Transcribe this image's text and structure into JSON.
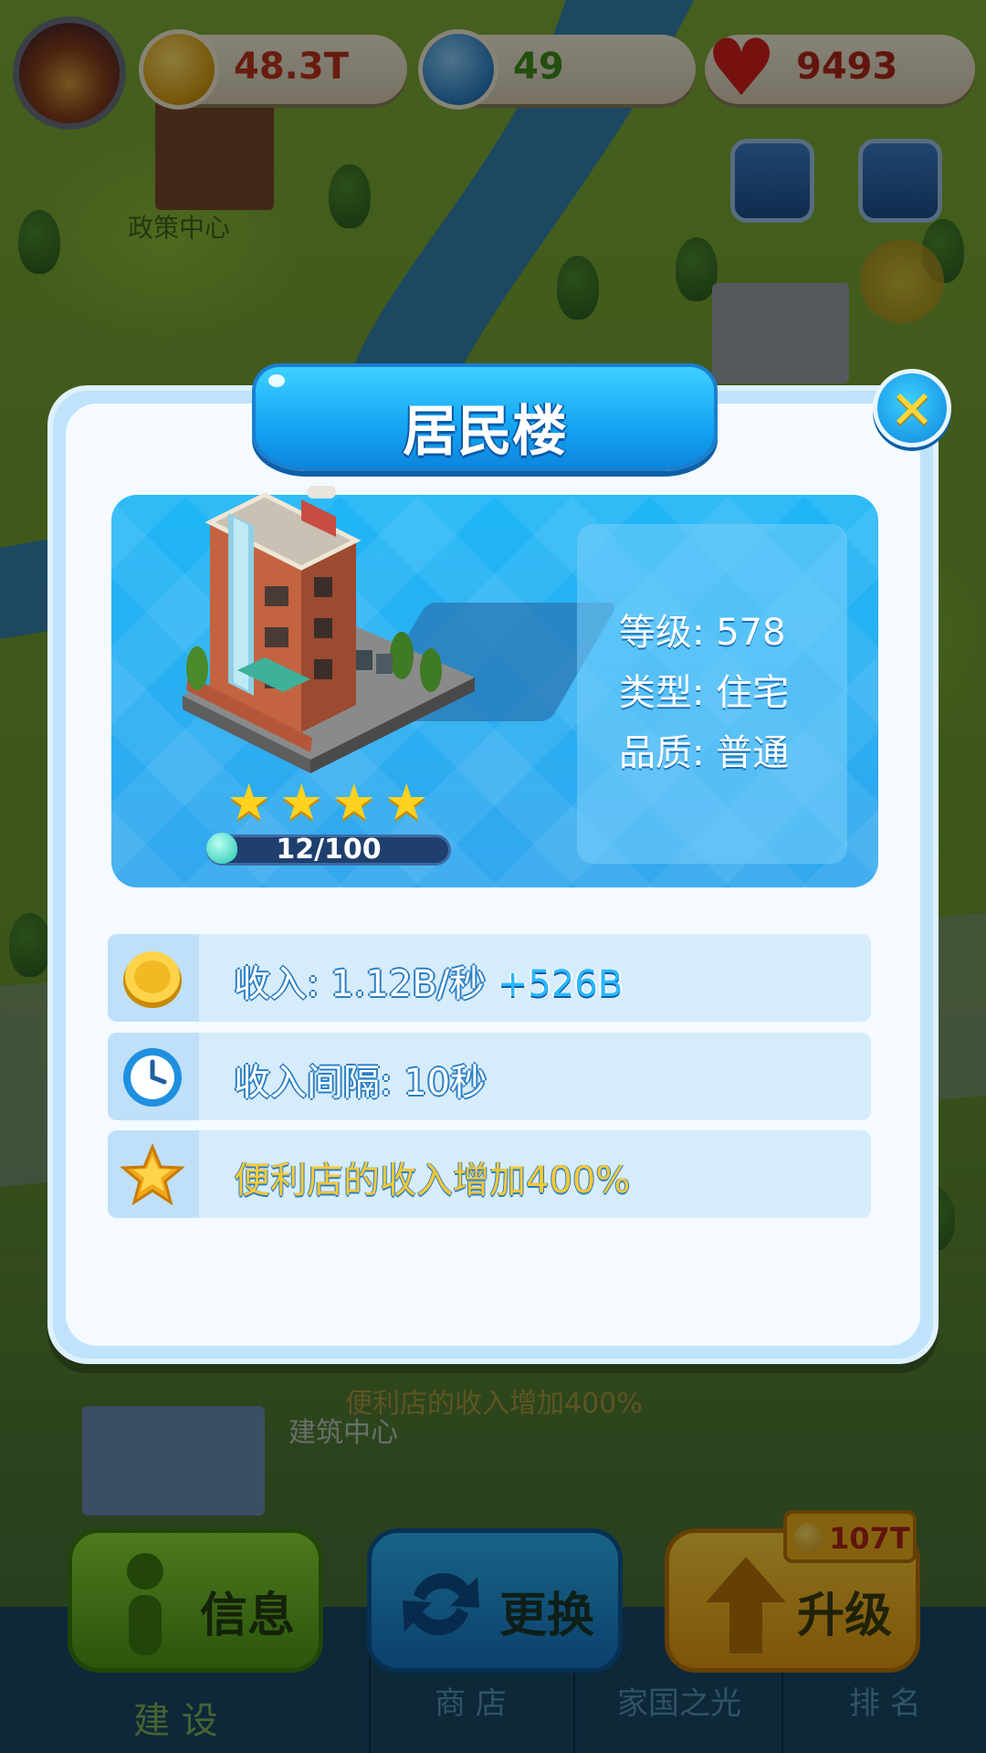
{
  "top_bar": {
    "coins": "48.3T",
    "gems": "49",
    "hearts": "9493"
  },
  "map_labels": {
    "policy_center": "政策中心",
    "building_center": "建筑中心",
    "bg_bonus": "便利店的收入增加400%"
  },
  "dialog": {
    "title": "居民楼",
    "close_icon": "close-x-icon",
    "stars": 4,
    "progress_text": "12/100",
    "progress_fraction": 0.12,
    "level": "等级: 578",
    "type": "类型: 住宅",
    "quality": "品质: 普通",
    "rows": [
      {
        "icon": "coin-icon",
        "text": "收入: 1.12B/秒",
        "accent": "+526B"
      },
      {
        "icon": "clock-icon",
        "text": "收入间隔: 10秒",
        "accent": ""
      },
      {
        "icon": "star-icon",
        "text": "便利店的收入增加400%",
        "accent": ""
      }
    ]
  },
  "actions": {
    "info": "信息",
    "swap": "更换",
    "upgrade": "升级",
    "upgrade_cost": "107T"
  },
  "tabs": [
    "建 设",
    "商 店",
    "家国之光",
    "排 名"
  ],
  "colors": {
    "banner": "#16a8f5",
    "gold_text": "#ffc933",
    "accent_income": "#2ab8ff"
  }
}
